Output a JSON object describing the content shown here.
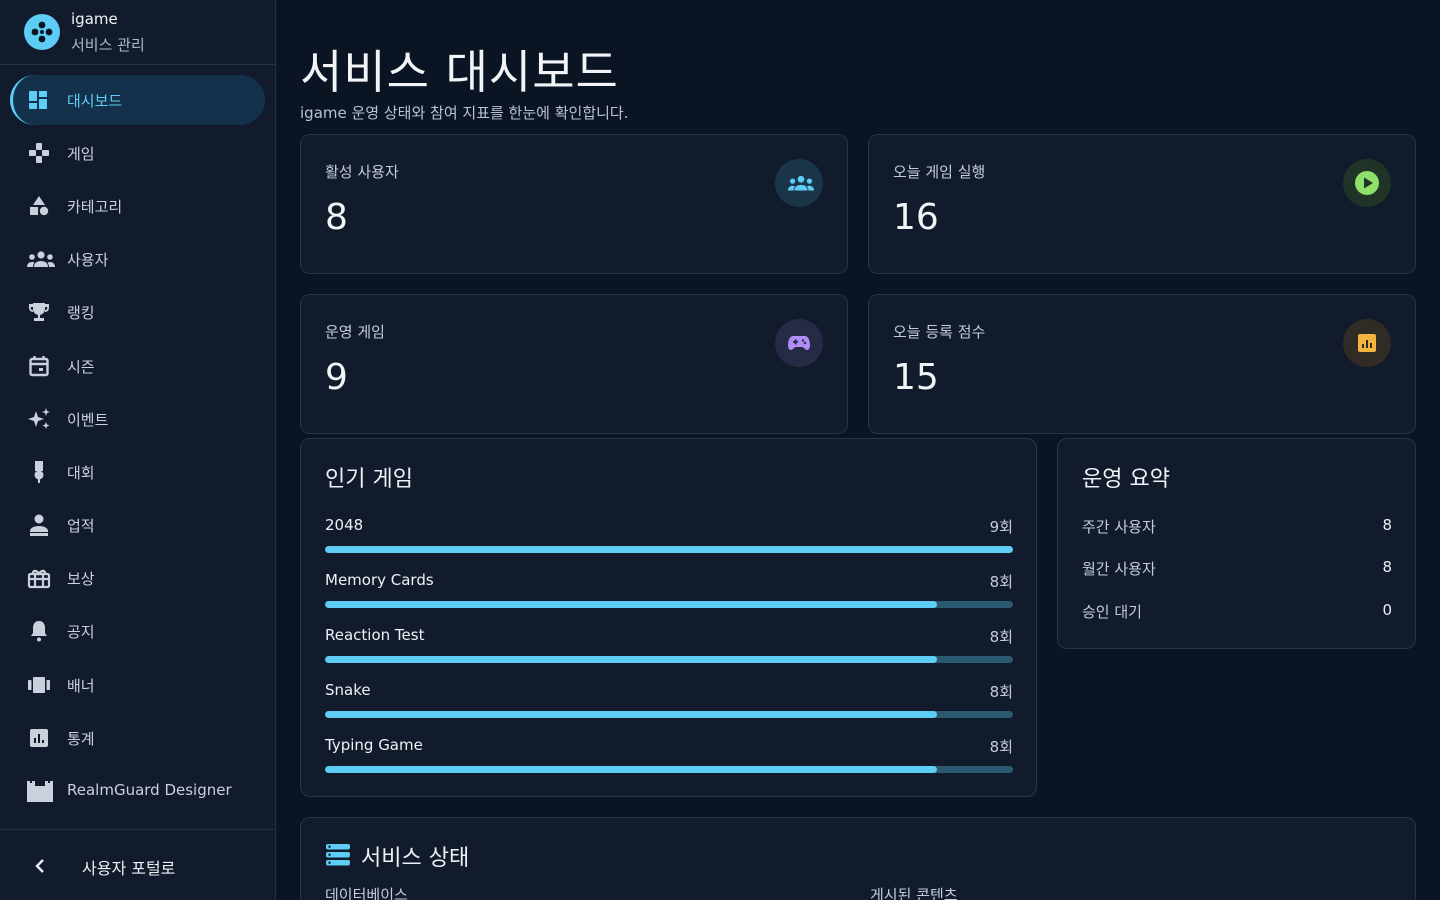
{
  "brand": {
    "name": "igame",
    "subtitle": "서비스 관리"
  },
  "nav": [
    {
      "label": "대시보드",
      "icon": "dashboard-icon",
      "active": true
    },
    {
      "label": "게임",
      "icon": "gamepad-icon"
    },
    {
      "label": "카테고리",
      "icon": "category-icon"
    },
    {
      "label": "사용자",
      "icon": "users-icon"
    },
    {
      "label": "랭킹",
      "icon": "trophy-icon"
    },
    {
      "label": "시즌",
      "icon": "calendar-icon"
    },
    {
      "label": "이벤트",
      "icon": "sparkle-icon"
    },
    {
      "label": "대회",
      "icon": "medal-icon"
    },
    {
      "label": "업적",
      "icon": "achievement-icon"
    },
    {
      "label": "보상",
      "icon": "gift-icon"
    },
    {
      "label": "공지",
      "icon": "bell-icon"
    },
    {
      "label": "배너",
      "icon": "banner-icon"
    },
    {
      "label": "통계",
      "icon": "stats-icon"
    },
    {
      "label": "RealmGuard Designer",
      "icon": "castle-icon"
    }
  ],
  "footer": {
    "label": "사용자 포털로",
    "icon": "chevron-left-icon"
  },
  "header": {
    "title": "서비스 대시보드",
    "subtitle": "igame 운영 상태와 참여 지표를 한눈에 확인합니다."
  },
  "stats": [
    {
      "label": "활성 사용자",
      "value": "8",
      "icon": "users-icon",
      "color": "#5dcdf5",
      "badge_bg": "#1a3448"
    },
    {
      "label": "오늘 게임 실행",
      "value": "16",
      "icon": "play-icon",
      "color": "#8ee06a",
      "badge_bg": "#1f3326"
    },
    {
      "label": "운영 게임",
      "value": "9",
      "icon": "gamepad-icon",
      "color": "#b08cf5",
      "badge_bg": "#262a45"
    },
    {
      "label": "오늘 등록 점수",
      "value": "15",
      "icon": "chart-icon",
      "color": "#f2b43c",
      "badge_bg": "#302b25"
    }
  ],
  "popular": {
    "title": "인기 게임",
    "games": [
      {
        "name": "2048",
        "count": "9회",
        "plays": 9
      },
      {
        "name": "Memory Cards",
        "count": "8회",
        "plays": 8
      },
      {
        "name": "Reaction Test",
        "count": "8회",
        "plays": 8
      },
      {
        "name": "Snake",
        "count": "8회",
        "plays": 8
      },
      {
        "name": "Typing Game",
        "count": "8회",
        "plays": 8
      }
    ]
  },
  "summary": {
    "title": "운영 요약",
    "rows": [
      {
        "label": "주간 사용자",
        "value": "8"
      },
      {
        "label": "월간 사용자",
        "value": "8"
      },
      {
        "label": "승인 대기",
        "value": "0"
      }
    ]
  },
  "service_status": {
    "title": "서비스 상태",
    "columns": [
      "데이터베이스",
      "게시된 콘텐츠"
    ]
  },
  "colors": {
    "accent": "#5dcdf5",
    "background": "#0b1422",
    "surface": "#111b2b"
  }
}
